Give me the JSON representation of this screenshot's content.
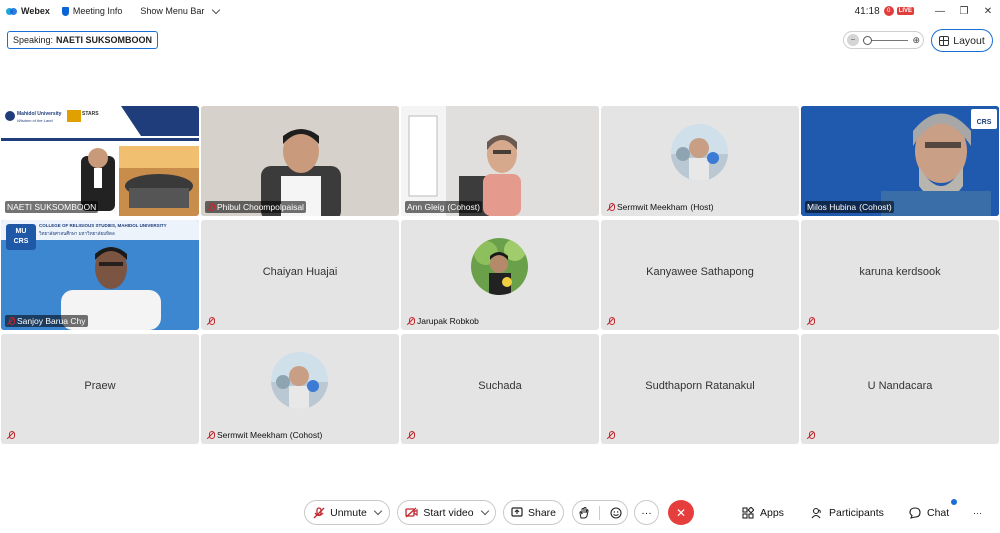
{
  "titlebar": {
    "app_name": "Webex",
    "meeting_info": "Meeting Info",
    "show_menu_bar": "Show Menu Bar",
    "timer": "41:18",
    "rec_count": "0",
    "live": "LIVE"
  },
  "speaking": {
    "prefix": "Speaking:",
    "name": "NAETI SUKSOMBOON"
  },
  "layout_label": "Layout",
  "tiles": [
    {
      "name": "NAETI SUKSOMBOON",
      "status": "",
      "center": ""
    },
    {
      "name": "Phibul Choompolpaisal",
      "status": "",
      "center": ""
    },
    {
      "name": "Ann Gleig",
      "status": "(Cohost)",
      "center": ""
    },
    {
      "name": "Sermwit Meekham",
      "status": "(Host)",
      "center": ""
    },
    {
      "name": "Milos Hubina",
      "status": "(Cohost)",
      "center": ""
    },
    {
      "name": "Sanjoy Barua Chy",
      "status": "",
      "center": ""
    },
    {
      "name": "",
      "status": "",
      "center": "Chaiyan Huajai"
    },
    {
      "name": "Jarupak Robkob",
      "status": "",
      "center": ""
    },
    {
      "name": "",
      "status": "",
      "center": "Kanyawee Sathapong"
    },
    {
      "name": "",
      "status": "",
      "center": "karuna kerdsook"
    },
    {
      "name": "",
      "status": "",
      "center": "Praew"
    },
    {
      "name": "Sermwit Meekham (Cohost)",
      "status": "",
      "center": ""
    },
    {
      "name": "",
      "status": "",
      "center": "Suchada"
    },
    {
      "name": "",
      "status": "",
      "center": "Sudthaporn Ratanakul"
    },
    {
      "name": "",
      "status": "",
      "center": "U Nandacara"
    }
  ],
  "slide": {
    "university": "Mahidol University",
    "motto": "Wisdom of the Land",
    "stars": "STARS"
  },
  "crs_banner": {
    "logo_top": "MU",
    "logo_bottom": "CRS",
    "line1": "COLLEGE OF RELIGIOUS STUDIES, MAHIDOL UNIVERSITY",
    "line2": "วิทยาลัยศาสนศึกษา มหาวิทยาลัยมหิดล"
  },
  "crs_corner": "CRS",
  "toolbar": {
    "unmute": "Unmute",
    "start_video": "Start video",
    "share": "Share",
    "more": "···",
    "apps": "Apps",
    "participants": "Participants",
    "chat": "Chat",
    "overflow": "···"
  },
  "colors": {
    "accent": "#1a6fd6",
    "leave": "#e63d3d",
    "muted_icon": "#c0272d",
    "tile_bg": "#e4e4e4"
  }
}
